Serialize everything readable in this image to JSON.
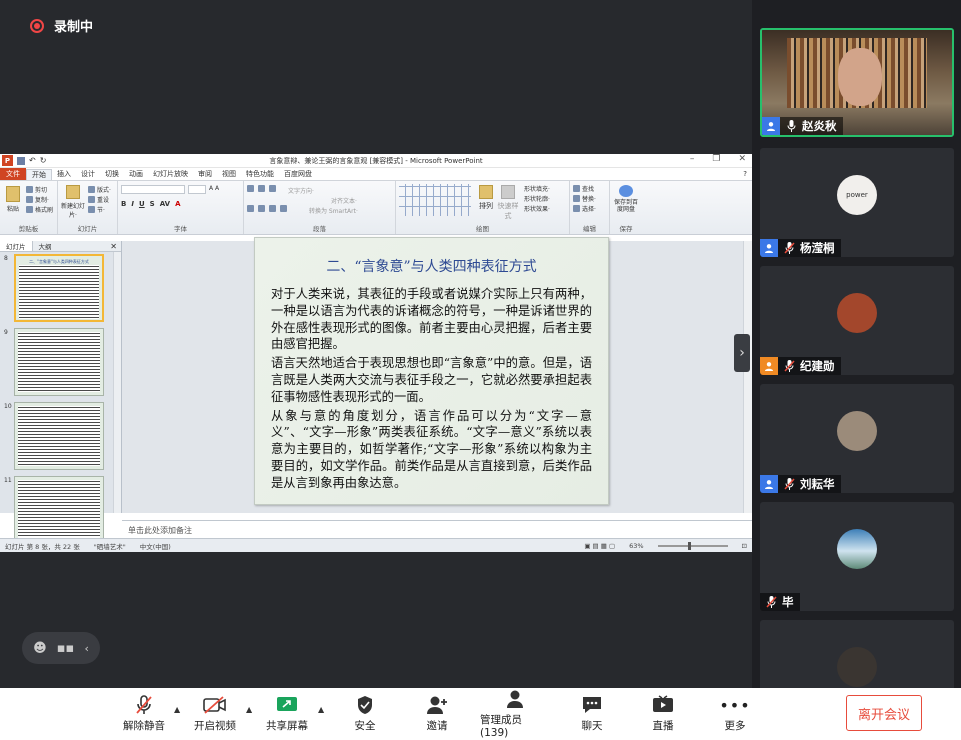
{
  "recording": {
    "label": "录制中"
  },
  "ppt": {
    "window_title": "言象意辩、兼论王弼的言象意观 [兼容模式] - Microsoft PowerPoint",
    "menu": [
      "文件",
      "开始",
      "插入",
      "设计",
      "切换",
      "动画",
      "幻灯片放映",
      "审阅",
      "视图",
      "特色功能",
      "百度网盘"
    ],
    "ribbon_groups": [
      "剪贴板",
      "幻灯片",
      "字体",
      "段落",
      "绘图",
      "编辑",
      "保存"
    ],
    "ribbon_items": {
      "paste": "粘贴",
      "cut": "剪切",
      "copy": "复制·",
      "format_painter": "格式刷",
      "new_slide": "新建幻灯片·",
      "layout": "版式·",
      "reset": "重设",
      "section": "节·",
      "text_direction": "文字方向·",
      "align_text": "对齐文本·",
      "smartart": "转换为 SmartArt·",
      "arrange": "排列",
      "quick_styles": "快速样式",
      "shape_fill": "形状填充·",
      "shape_outline": "形状轮廓·",
      "shape_effects": "形状效果·",
      "find": "查找",
      "replace": "替换·",
      "select": "选择·",
      "save_baidu": "保存到百度网盘"
    },
    "pane_tabs": [
      "幻灯片",
      "大纲"
    ],
    "thumb_numbers": [
      "8",
      "9",
      "10",
      "11"
    ],
    "thumb8_title": "二、\"言象意\"与人类四种表征方式",
    "slide": {
      "title": "二、“言象意”与人类四种表征方式",
      "paragraphs": [
        "对于人类来说，其表征的手段或者说媒介实际上只有两种，一种是以语言为代表的诉诸概念的符号，一种是诉诸世界的外在感性表现形式的图像。前者主要由心灵把握，后者主要由感官把握。",
        "语言天然地适合于表现思想也即“言象意”中的意。但是，语言既是人类两大交流与表征手段之一，它就必然要承担起表征事物感性表现形式的一面。",
        "从象与意的角度划分，语言作品可以分为“文字—意义”、“文字—形象”两类表征系统。“文字—意义”系统以表意为主要目的，如哲学著作;“文字—形象”系统以构象为主要目的，如文学作品。前类作品是从言直接到意，后类作品是从言到象再由象达意。"
      ]
    },
    "notes_placeholder": "单击此处添加备注",
    "status": {
      "slide_info": "幻灯片 第 8 张，共 22 张",
      "theme": "\"硒墙艺术\"",
      "language": "中文(中国)",
      "zoom": "63%"
    }
  },
  "participants": [
    {
      "name": "赵炎秋",
      "host": true,
      "mic_on": true,
      "video": true
    },
    {
      "name": "杨滢桐",
      "host": true,
      "mic_on": false,
      "avatar_text": "power"
    },
    {
      "name": "纪建勋",
      "host": true,
      "mic_on": false,
      "badge_color": "#f08a24"
    },
    {
      "name": "刘耘华",
      "host": true,
      "mic_on": false
    },
    {
      "name": "毕",
      "host": false,
      "mic_on": false
    },
    {
      "name": "",
      "host": false,
      "mic_on": false
    }
  ],
  "toolbar": {
    "unmute": "解除静音",
    "video": "开启视频",
    "share": "共享屏幕",
    "security": "安全",
    "invite": "邀请",
    "members": "管理成员(139)",
    "chat": "聊天",
    "live": "直播",
    "more": "更多",
    "leave": "离开会议"
  },
  "colors": {
    "accent_green": "#27c06c",
    "leave_red": "#e74c3c",
    "host_blue": "#3b78e7",
    "slide_title": "#2e4a93"
  }
}
